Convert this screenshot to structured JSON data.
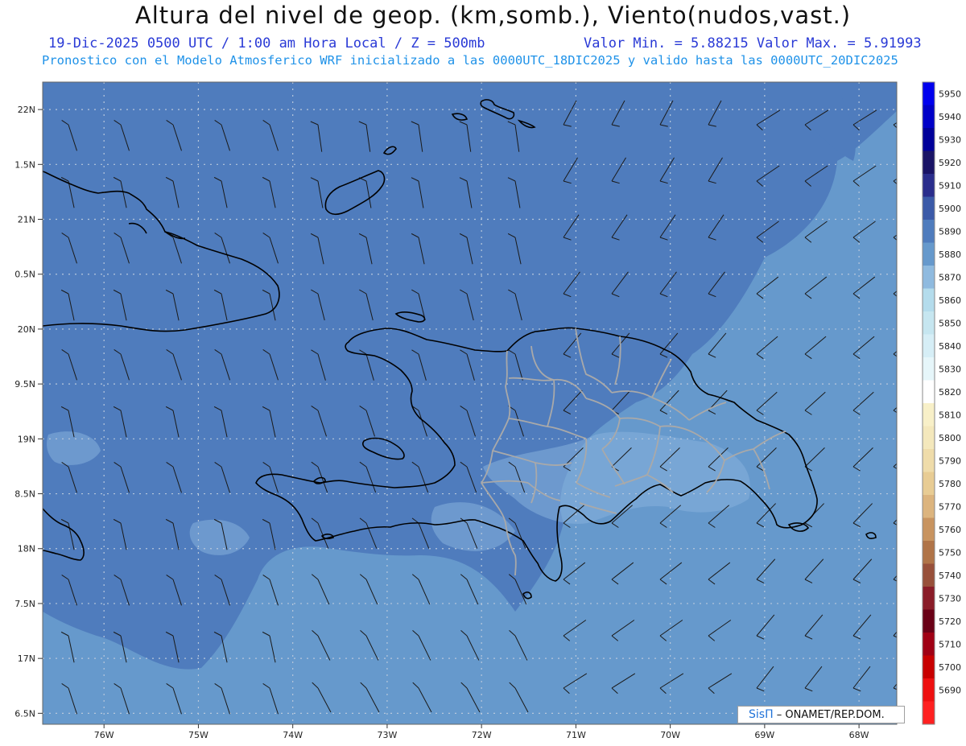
{
  "header": {
    "title": "Altura del nivel de geop. (km,somb.), Viento(nudos,vast.)",
    "subtitle_left": "19-Dic-2025   0500 UTC / 1:00 am Hora Local / Z = 500mb",
    "subtitle_right": "Valor Min. = 5.88215  Valor Max. = 5.91993",
    "subtitle_model": "Pronostico con el Modelo Atmosferico WRF inicializado a las 0000UTC_18DIC2025 y valido hasta las  0000UTC_20DIC2025"
  },
  "map": {
    "lat_ticks": [
      "22N",
      "1.5N",
      "21N",
      "0.5N",
      "20N",
      "9.5N",
      "19N",
      "8.5N",
      "18N",
      "7.5N",
      "17N",
      "6.5N"
    ],
    "lon_ticks": [
      "76W",
      "75W",
      "74W",
      "73W",
      "72W",
      "71W",
      "70W",
      "69W",
      "68W"
    ],
    "lat_range": [
      16.4,
      22.25
    ],
    "lon_range": [
      -76.65,
      -67.6
    ],
    "colors": {
      "field_deep": "#4f7cbd",
      "field_mid": "#6699cc",
      "field_light": "#87b1dc",
      "coast": "#000000",
      "province_border": "#a9a9a9",
      "barb": "#1a1a1a"
    }
  },
  "colorbar": {
    "labels": [
      "5950",
      "5940",
      "5930",
      "5920",
      "5910",
      "5900",
      "5890",
      "5880",
      "5870",
      "5860",
      "5850",
      "5840",
      "5830",
      "5820",
      "5810",
      "5800",
      "5790",
      "5780",
      "5770",
      "5760",
      "5750",
      "5740",
      "5730",
      "5720",
      "5710",
      "5700",
      "5690"
    ],
    "colors": [
      "#0000ee",
      "#0000c8",
      "#00009a",
      "#1a1466",
      "#2a2d8c",
      "#3b5aa8",
      "#4f7cbd",
      "#6699cc",
      "#8fbadf",
      "#b4dcec",
      "#c6e6f0",
      "#d6eef6",
      "#e6f6fa",
      "#ffffff",
      "#f8f0c8",
      "#f4e8bc",
      "#efdcaa",
      "#e8cc94",
      "#dcb47e",
      "#c89460",
      "#b07448",
      "#98503a",
      "#8a1c28",
      "#6a0016",
      "#a00014",
      "#c80000",
      "#ee1010",
      "#ff2020"
    ]
  },
  "credit": {
    "brand": "SisΠ",
    "text": "– ONAMET/REP.DOM."
  }
}
